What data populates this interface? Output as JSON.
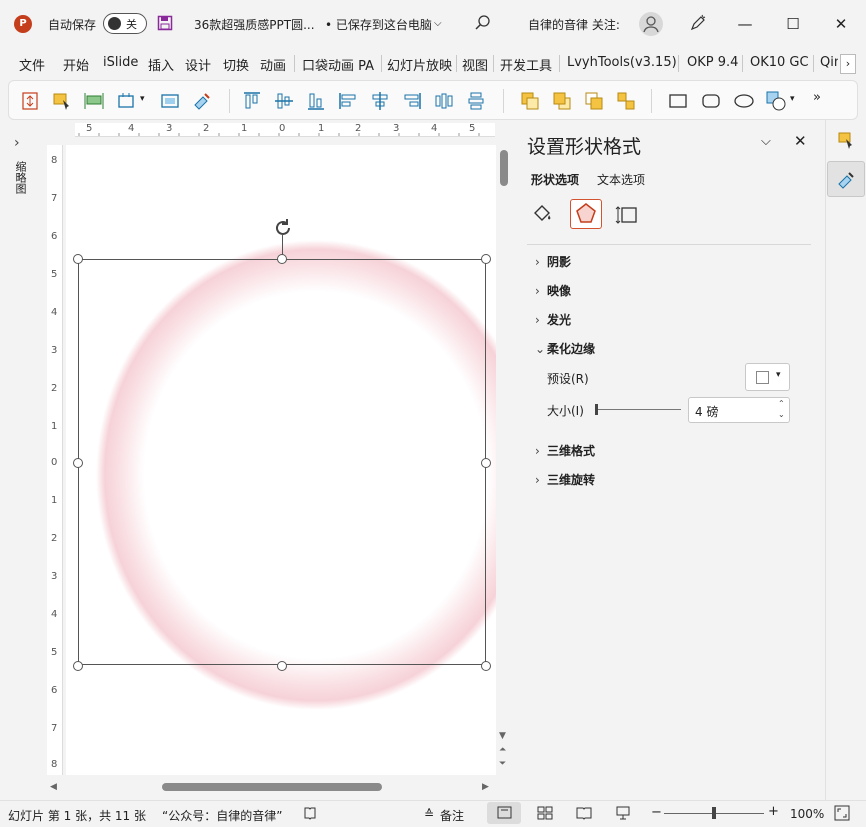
{
  "titlebar": {
    "autosave_label": "自动保存",
    "autosave_state": "关",
    "filename": "36款超强质感PPT圆...",
    "saved_status": "• 已保存到这台电脑",
    "user_text": "自律的音律 关注:"
  },
  "ribbon_tabs": [
    "文件",
    "开始",
    "iSlide",
    "插入",
    "设计",
    "切换",
    "动画",
    "口袋动画 PA",
    "幻灯片放映",
    "视图",
    "开发工具",
    "LvyhTools(v3.15)",
    "OKP 9.4",
    "OK10 GC",
    "Qin"
  ],
  "left_strip": {
    "label": "缩略图"
  },
  "ruler": {
    "h_labels": [
      "5",
      "4",
      "3",
      "2",
      "1",
      "0",
      "1",
      "2",
      "3",
      "4",
      "5"
    ],
    "v_labels": [
      "8",
      "7",
      "6",
      "5",
      "4",
      "3",
      "2",
      "1",
      "0",
      "1",
      "2",
      "3",
      "4",
      "5",
      "6",
      "7",
      "8"
    ]
  },
  "pane": {
    "title": "设置形状格式",
    "tabs": [
      "形状选项",
      "文本选项"
    ],
    "sections_top": [
      {
        "label": "阴影"
      },
      {
        "label": "映像"
      },
      {
        "label": "发光"
      },
      {
        "label": "柔化边缘"
      }
    ],
    "preset_label": "预设(R)",
    "size_label": "大小(I)",
    "size_value": "4 磅",
    "sections_bottom": [
      {
        "label": "三维格式"
      },
      {
        "label": "三维旋转"
      }
    ]
  },
  "status": {
    "slide_info": "幻灯片 第 1 张，共 11 张",
    "account": "“公众号：自律的音律”",
    "notes": "备注",
    "zoom": "100%"
  },
  "colors": {
    "accent": "#c43e1c",
    "selected_tab_border": "#d35230"
  }
}
